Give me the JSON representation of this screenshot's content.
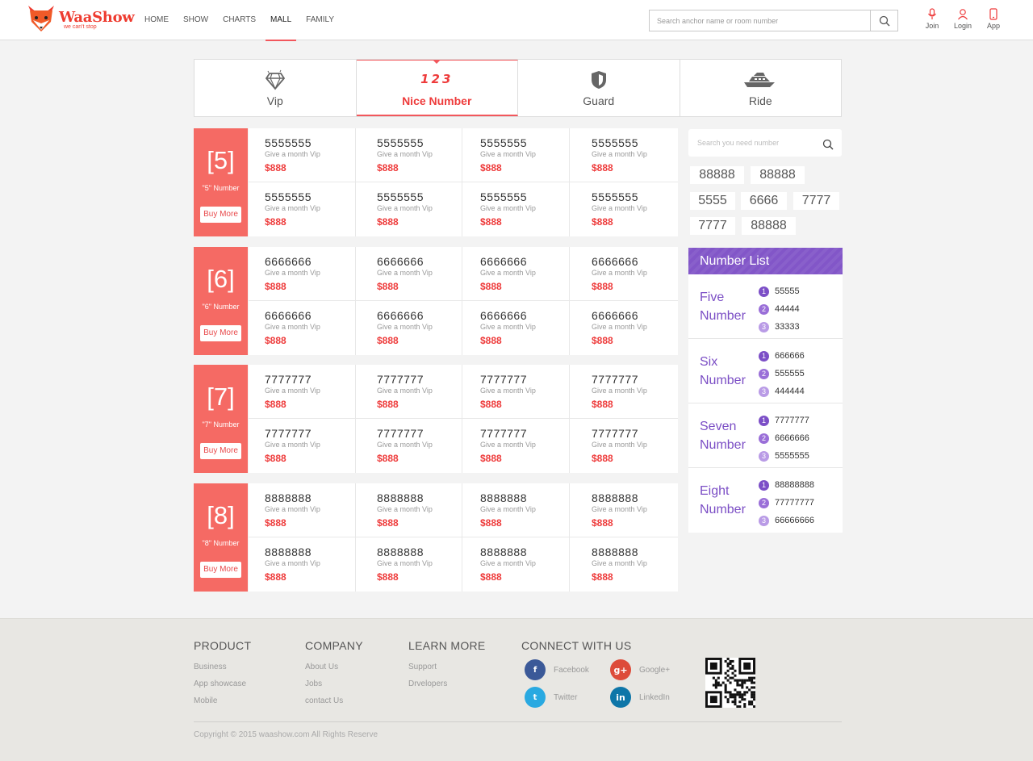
{
  "brand": {
    "name": "WaaShow",
    "slogan": "we can't stop"
  },
  "nav": [
    {
      "label": "HOME",
      "active": false
    },
    {
      "label": "SHOW",
      "active": false
    },
    {
      "label": "CHARTS",
      "active": false
    },
    {
      "label": "MALL",
      "active": true
    },
    {
      "label": "FAMILY",
      "active": false
    }
  ],
  "search": {
    "placeholder": "Search anchor name or room number"
  },
  "tools": [
    {
      "label": "Join",
      "icon": "microphone-icon"
    },
    {
      "label": "Login",
      "icon": "user-icon"
    },
    {
      "label": "App",
      "icon": "phone-icon"
    }
  ],
  "categories": [
    {
      "label": "Vip",
      "icon": "diamond-icon",
      "active": false
    },
    {
      "label": "Nice Number",
      "icon": "nice-number-icon",
      "digits": "123",
      "active": true
    },
    {
      "label": "Guard",
      "icon": "shield-icon",
      "active": false
    },
    {
      "label": "Ride",
      "icon": "yacht-icon",
      "active": false
    }
  ],
  "groups": [
    {
      "big": "[5]",
      "sub": "\"5\" Number",
      "buy": "Buy More",
      "items": [
        {
          "num": "5555555",
          "desc": "Give a month Vip",
          "price": "$888"
        },
        {
          "num": "5555555",
          "desc": "Give a month Vip",
          "price": "$888"
        },
        {
          "num": "5555555",
          "desc": "Give a month Vip",
          "price": "$888"
        },
        {
          "num": "5555555",
          "desc": "Give a month Vip",
          "price": "$888"
        },
        {
          "num": "5555555",
          "desc": "Give a month Vip",
          "price": "$888"
        },
        {
          "num": "5555555",
          "desc": "Give a month Vip",
          "price": "$888"
        },
        {
          "num": "5555555",
          "desc": "Give a month Vip",
          "price": "$888"
        },
        {
          "num": "5555555",
          "desc": "Give a month Vip",
          "price": "$888"
        }
      ]
    },
    {
      "big": "[6]",
      "sub": "\"6\" Number",
      "buy": "Buy More",
      "items": [
        {
          "num": "6666666",
          "desc": "Give a month Vip",
          "price": "$888"
        },
        {
          "num": "6666666",
          "desc": "Give a month Vip",
          "price": "$888"
        },
        {
          "num": "6666666",
          "desc": "Give a month Vip",
          "price": "$888"
        },
        {
          "num": "6666666",
          "desc": "Give a month Vip",
          "price": "$888"
        },
        {
          "num": "6666666",
          "desc": "Give a month Vip",
          "price": "$888"
        },
        {
          "num": "6666666",
          "desc": "Give a month Vip",
          "price": "$888"
        },
        {
          "num": "6666666",
          "desc": "Give a month Vip",
          "price": "$888"
        },
        {
          "num": "6666666",
          "desc": "Give a month Vip",
          "price": "$888"
        }
      ]
    },
    {
      "big": "[7]",
      "sub": "\"7\" Number",
      "buy": "Buy More",
      "items": [
        {
          "num": "7777777",
          "desc": "Give a month Vip",
          "price": "$888"
        },
        {
          "num": "7777777",
          "desc": "Give a month Vip",
          "price": "$888"
        },
        {
          "num": "7777777",
          "desc": "Give a month Vip",
          "price": "$888"
        },
        {
          "num": "7777777",
          "desc": "Give a month Vip",
          "price": "$888"
        },
        {
          "num": "7777777",
          "desc": "Give a month Vip",
          "price": "$888"
        },
        {
          "num": "7777777",
          "desc": "Give a month Vip",
          "price": "$888"
        },
        {
          "num": "7777777",
          "desc": "Give a month Vip",
          "price": "$888"
        },
        {
          "num": "7777777",
          "desc": "Give a month Vip",
          "price": "$888"
        }
      ]
    },
    {
      "big": "[8]",
      "sub": "\"8\" Number",
      "buy": "Buy More",
      "items": [
        {
          "num": "8888888",
          "desc": "Give a month Vip",
          "price": "$888"
        },
        {
          "num": "8888888",
          "desc": "Give a month Vip",
          "price": "$888"
        },
        {
          "num": "8888888",
          "desc": "Give a month Vip",
          "price": "$888"
        },
        {
          "num": "8888888",
          "desc": "Give a month Vip",
          "price": "$888"
        },
        {
          "num": "8888888",
          "desc": "Give a month Vip",
          "price": "$888"
        },
        {
          "num": "8888888",
          "desc": "Give a month Vip",
          "price": "$888"
        },
        {
          "num": "8888888",
          "desc": "Give a month Vip",
          "price": "$888"
        },
        {
          "num": "8888888",
          "desc": "Give a month Vip",
          "price": "$888"
        }
      ]
    }
  ],
  "side_search": {
    "placeholder": "Search you need number"
  },
  "tags": [
    "88888",
    "88888",
    "5555",
    "6666",
    "7777",
    "7777",
    "88888"
  ],
  "number_list": {
    "title": "Number List",
    "rows": [
      {
        "name": [
          "Five",
          "Number"
        ],
        "items": [
          "55555",
          "44444",
          "33333"
        ]
      },
      {
        "name": [
          "Six",
          "Number"
        ],
        "items": [
          "666666",
          "555555",
          "444444"
        ]
      },
      {
        "name": [
          "Seven",
          "Number"
        ],
        "items": [
          "7777777",
          "6666666",
          "5555555"
        ]
      },
      {
        "name": [
          "Eight",
          "Number"
        ],
        "items": [
          "88888888",
          "77777777",
          "66666666"
        ]
      }
    ],
    "ranks": [
      "1",
      "2",
      "3"
    ]
  },
  "footer": {
    "product": {
      "title": "PRODUCT",
      "links": [
        "Business",
        "App showcase",
        "Mobile"
      ]
    },
    "company": {
      "title": "COMPANY",
      "links": [
        "About Us",
        "Jobs",
        "contact Us"
      ]
    },
    "learn": {
      "title": "LEARN MORE",
      "links": [
        "Support",
        "Drvelopers"
      ]
    },
    "connect": {
      "title": "CONNECT WITH US",
      "social": [
        {
          "label": "Facebook",
          "glyph": "f",
          "color": "#3b5998",
          "icon": "facebook-icon"
        },
        {
          "label": "Google+",
          "glyph": "g+",
          "color": "#dd4b39",
          "icon": "google-plus-icon"
        },
        {
          "label": "Twitter",
          "glyph": "t",
          "color": "#29a9e1",
          "icon": "twitter-icon"
        },
        {
          "label": "LinkedIn",
          "glyph": "in",
          "color": "#0e76a8",
          "icon": "linkedin-icon"
        }
      ]
    },
    "copyright": "Copyright © 2015 waashow.com All Rights Reserve"
  },
  "colors": {
    "accent": "#f2575c",
    "group_bg": "#f56a64",
    "purple": "#8256c8"
  }
}
